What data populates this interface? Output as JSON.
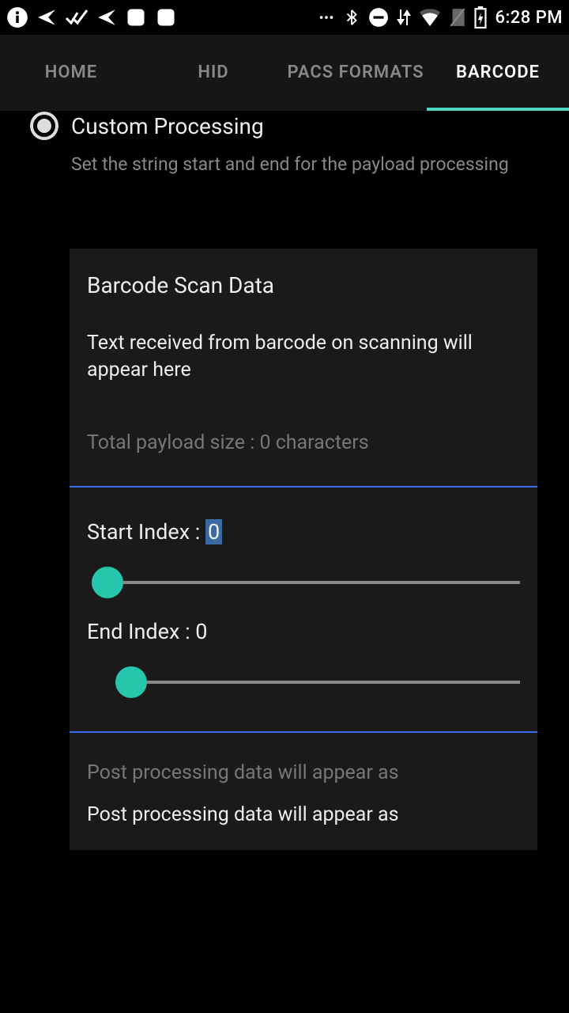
{
  "status": {
    "time": "6:28 PM"
  },
  "tabs": {
    "home": "HOME",
    "hid": "HID",
    "pacs": "PACS FORMATS",
    "barcode": "BARCODE"
  },
  "radio": {
    "label": "Custom Processing",
    "sub": "Set the string start and end for the payload processing"
  },
  "card": {
    "title": "Barcode Scan Data",
    "text": "Text received from barcode on scanning will appear here",
    "payload": "Total payload size : 0 characters"
  },
  "sliders": {
    "start_label_prefix": "Start Index : ",
    "start_value": "0",
    "end_label": "End Index : 0"
  },
  "post": {
    "label": "Post processing data will appear as",
    "value": "Post processing data will appear as"
  }
}
